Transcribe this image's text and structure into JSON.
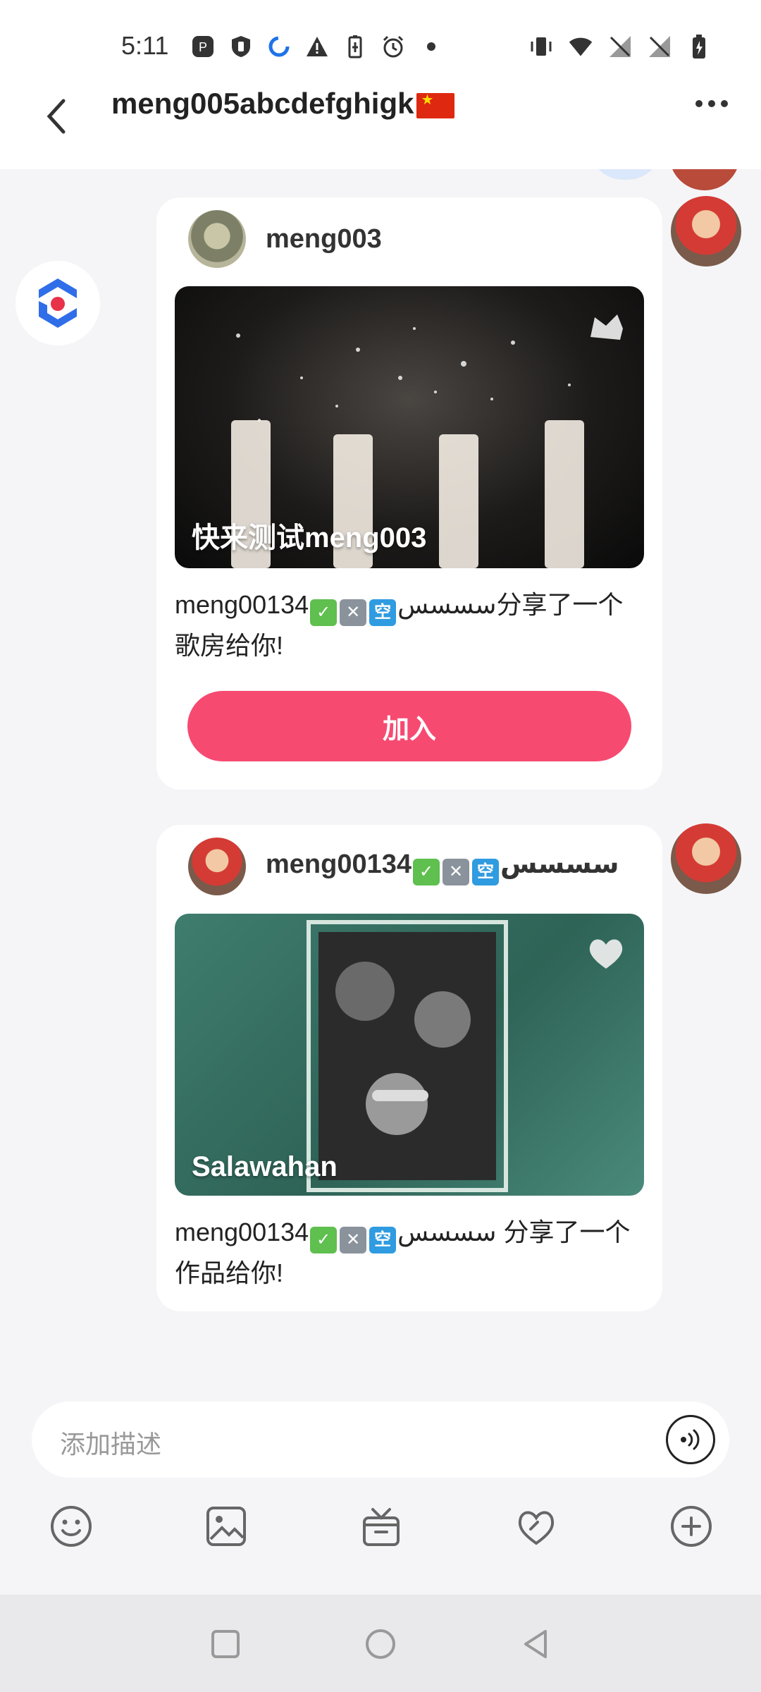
{
  "status_bar": {
    "time": "5:11",
    "left_icons": [
      "app-icon",
      "shield-icon",
      "loading-icon",
      "warning-icon",
      "battery-saver-icon",
      "alarm-icon",
      "dot-icon"
    ],
    "right_icons": [
      "vibrate-icon",
      "wifi-icon",
      "no-signal-icon",
      "no-signal-icon",
      "battery-charging-icon"
    ]
  },
  "header": {
    "title": "meng005abcdefghigk",
    "flag": "china-flag",
    "back_icon": "chevron-left-icon",
    "more_icon": "more-icon"
  },
  "messages": [
    {
      "type": "room_share",
      "sender_name": "meng003",
      "media_title": "快来测试meng003",
      "media_badge": "shoe-icon",
      "text_prefix": "meng001سسسس",
      "text_suffix": "34分享了一个歌房给你!",
      "button_label": "加入"
    },
    {
      "type": "work_share",
      "sender_name_prefix": "meng001سسسس",
      "sender_name_suffix": "34",
      "media_title": "Salawahan",
      "media_badge": "heart-music-icon",
      "text_prefix": "meng001سسسس",
      "text_suffix": "34 分享了一个作品给你!"
    }
  ],
  "emoji": {
    "kong": "空"
  },
  "input": {
    "placeholder": "添加描述"
  },
  "toolbar_icons": [
    "smile-icon",
    "image-icon",
    "gift-icon",
    "music-heart-icon",
    "plus-icon"
  ],
  "nav_icons": [
    "square-icon",
    "circle-icon",
    "triangle-back-icon"
  ],
  "colors": {
    "accent": "#f74a71",
    "background": "#f5f5f7",
    "card": "#ffffff"
  }
}
